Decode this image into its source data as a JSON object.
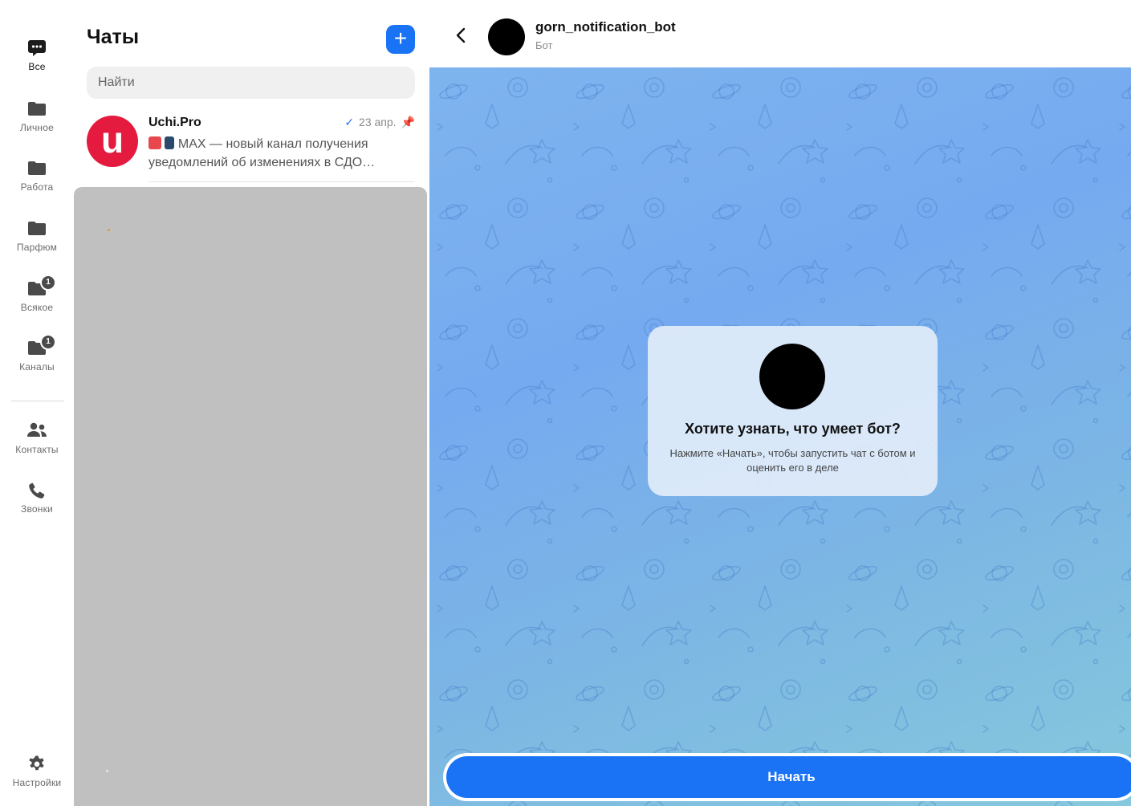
{
  "rail": {
    "items": [
      {
        "label": "Все",
        "icon": "chat-bubble-icon",
        "active": true
      },
      {
        "label": "Личное",
        "icon": "folder-icon"
      },
      {
        "label": "Работа",
        "icon": "folder-icon"
      },
      {
        "label": "Парфюм",
        "icon": "folder-icon"
      },
      {
        "label": "Всякое",
        "icon": "folder-icon",
        "badge": "1"
      },
      {
        "label": "Каналы",
        "icon": "folder-icon",
        "badge": "1"
      },
      {
        "label": "Контакты",
        "icon": "contacts-icon"
      },
      {
        "label": "Звонки",
        "icon": "phone-icon"
      }
    ],
    "settings": {
      "label": "Настройки",
      "icon": "gear-icon"
    }
  },
  "chats": {
    "title": "Чаты",
    "new_chat_label": "+",
    "search_placeholder": "Найти",
    "items": [
      {
        "name": "Uchi.Pro",
        "avatar_letter": "u",
        "date": "23 апр.",
        "preview": "MAX — новый канал получения уведомлений об изменениях в СДО…"
      }
    ]
  },
  "conversation": {
    "name": "gorn_notification_bot",
    "subtitle": "Бот",
    "card_title": "Хотите узнать, что умеет бот?",
    "card_text": "Нажмите «Начать», чтобы запустить чат с ботом и оценить его в деле",
    "start_button": "Начать"
  },
  "colors": {
    "accent": "#1a73f5",
    "avatar_red": "#e51a3f",
    "placeholder_block": "#c0c0c0"
  }
}
